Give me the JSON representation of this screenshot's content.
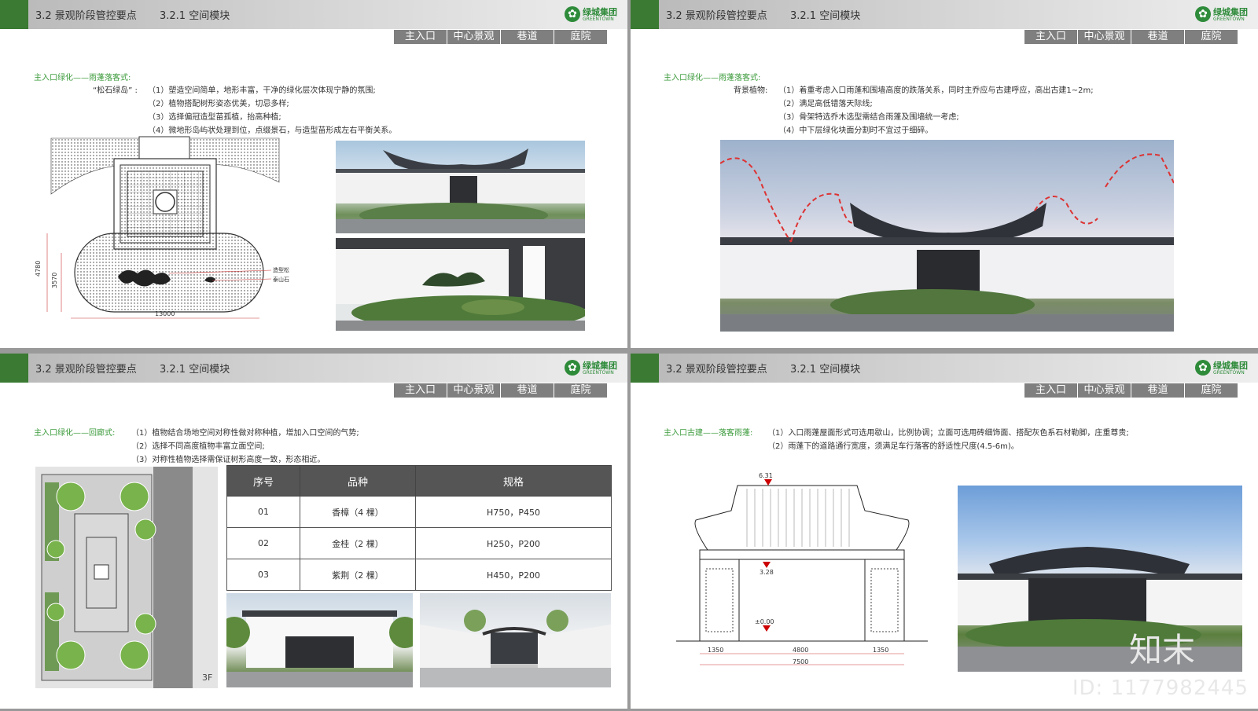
{
  "header": {
    "section": "3.2 景观阶段管控要点",
    "module": "3.2.1 空间模块"
  },
  "logo": {
    "cn": "绿城集团",
    "en": "GREENTOWN",
    "icon": "greentown-logo-icon",
    "color": "#2e8b3a"
  },
  "tabs": [
    "主入口",
    "中心景观",
    "巷道",
    "庭院"
  ],
  "colors": {
    "brand_green": "#3a7a32",
    "subtitle_green": "#3a9a3a",
    "tab_gray": "#7f7f7f"
  },
  "slide1": {
    "subtitle": "主入口绿化——雨蓬落客式:",
    "label": "“松石绿岛” :",
    "lines": [
      "（1）塑造空间简单，地形丰富，干净的绿化层次体现宁静的氛围;",
      "（2）植物搭配树形姿态优美，切忌多样;",
      "（3）选择偏冠造型苗孤植，抬高种植;",
      "（4）微地形岛屿状处理到位，点缀景石，与造型苗形成左右平衡关系。"
    ],
    "plan": {
      "dim_h1": "4780",
      "dim_h2": "3570",
      "dim_w": "13000",
      "tag1": "造型松",
      "tag2": "泰山石"
    }
  },
  "slide2": {
    "subtitle": "主入口绿化——雨蓬落客式:",
    "label": "背景植物:",
    "lines": [
      "（1）着重考虑入口雨蓬和围墙高度的跌落关系，同时主乔应与古建呼应，高出古建1~2m;",
      "（2）满足高低错落天际线;",
      "（3）骨架特选乔木选型需结合雨蓬及围墙统一考虑;",
      "（4）中下层绿化块面分割时不宜过于细碎。"
    ]
  },
  "slide3": {
    "subtitle": "主入口绿化——回廊式:",
    "lines": [
      "（1）植物结合场地空间对称性做对称种植，增加入口空间的气势;",
      "（2）选择不同高度植物丰富立面空间;",
      "（3）对称性植物选择需保证树形高度一致，形态相近。"
    ],
    "table": {
      "headers": [
        "序号",
        "品种",
        "规格"
      ],
      "rows": [
        [
          "01",
          "香樟（4 棵）",
          "H750，P450"
        ],
        [
          "02",
          "金桂（2 棵）",
          "H250，P200"
        ],
        [
          "03",
          "紫荆（2 棵）",
          "H450，P200"
        ]
      ]
    },
    "plan_label": "3F"
  },
  "slide4": {
    "subtitle": "主入口古建——落客雨蓬:",
    "lines": [
      "（1）入口雨蓬屋面形式可选用歇山，比例协调；立面可选用砖细饰面、搭配灰色系石材勒脚，庄重尊贵;",
      "（2）雨蓬下的道路通行宽度，须满足车行落客的舒适性尺度(4.5-6m)。"
    ],
    "elevation": {
      "top": "6.31",
      "mid": "3.28",
      "base": "±0.00",
      "d1": "1350",
      "d2": "4800",
      "d3": "1350",
      "total": "7500"
    },
    "watermark": "知末",
    "id": "ID: 1177982445"
  }
}
